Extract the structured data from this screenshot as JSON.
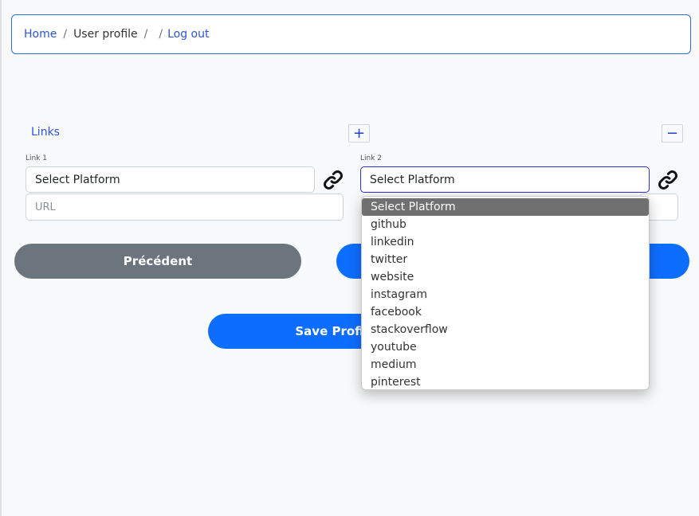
{
  "breadcrumb": {
    "home": "Home",
    "current": "User profile",
    "logout": "Log out",
    "sep": "/"
  },
  "links": {
    "title": "Links",
    "add_label": "+",
    "remove_label": "−",
    "link1": {
      "label": "Link 1",
      "select_value": "Select Platform",
      "url_placeholder": "URL"
    },
    "link2": {
      "label": "Link 2",
      "select_value": "Select Platform"
    }
  },
  "dropdown": {
    "options": [
      "Select Platform",
      "github",
      "linkedin",
      "twitter",
      "website",
      "instagram",
      "facebook",
      "stackoverflow",
      "youtube",
      "medium",
      "pinterest"
    ],
    "selected": "Select Platform"
  },
  "buttons": {
    "previous": "Précédent",
    "next": "",
    "save": "Save Profile"
  },
  "colors": {
    "accent": "#0d6efd",
    "secondary": "#6c757d",
    "link": "#2f53d6"
  },
  "icons": {
    "link": "link-icon"
  }
}
